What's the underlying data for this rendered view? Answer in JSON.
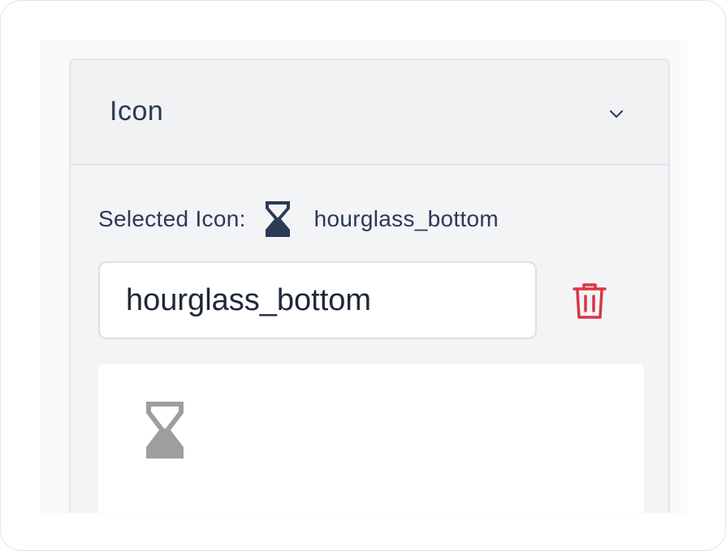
{
  "panel": {
    "title": "Icon",
    "collapse_icon": "chevron-down-icon"
  },
  "selected": {
    "label": "Selected Icon:",
    "icon": "hourglass-bottom-icon",
    "name": "hourglass_bottom"
  },
  "search": {
    "value": "hourglass_bottom",
    "placeholder": ""
  },
  "delete_button": {
    "icon": "trash-icon",
    "color": "#dc3545"
  },
  "results": [
    {
      "icon": "hourglass-bottom-icon",
      "color": "#9e9e9e"
    }
  ],
  "colors": {
    "text": "#2b3a55",
    "panel_bg": "#f3f4f6",
    "border": "#e3e5e9"
  }
}
